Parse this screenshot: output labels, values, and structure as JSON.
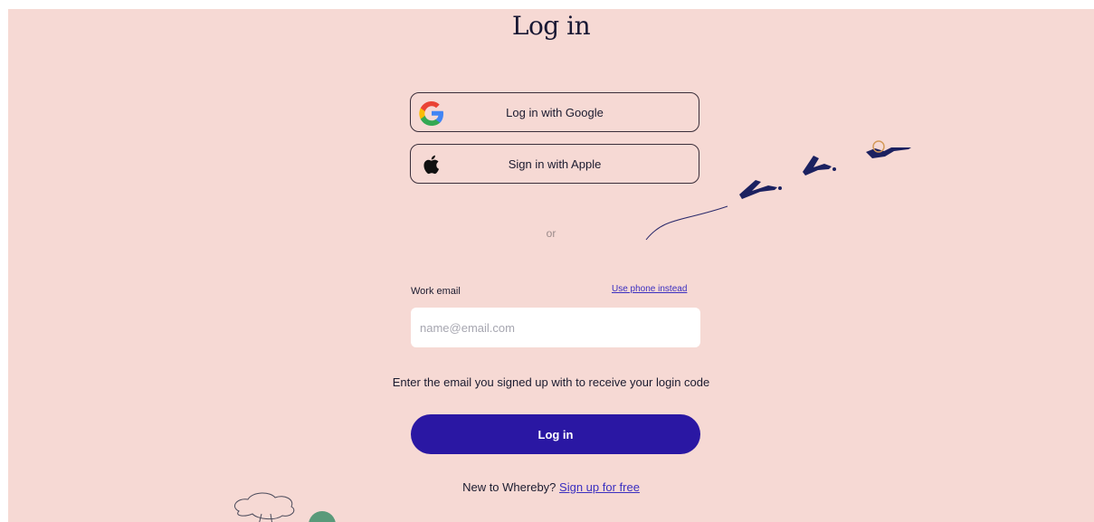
{
  "page": {
    "title": "Log in"
  },
  "sso": {
    "google_label": "Log in with Google",
    "apple_label": "Sign in with Apple"
  },
  "divider": {
    "text": "or"
  },
  "email": {
    "label": "Work email",
    "alt_link": "Use phone instead",
    "value": "",
    "placeholder": "name@email.com"
  },
  "helper_text": "Enter the email you signed up with to receive your login code",
  "submit": {
    "label": "Log in"
  },
  "signup": {
    "prompt": "New to Whereby?",
    "link": "Sign up for free"
  },
  "colors": {
    "background": "#f6d9d4",
    "primary_button": "#2a17a3",
    "link": "#3b2fc0"
  },
  "icons": {
    "google": "google-logo-icon",
    "apple": "apple-logo-icon"
  }
}
